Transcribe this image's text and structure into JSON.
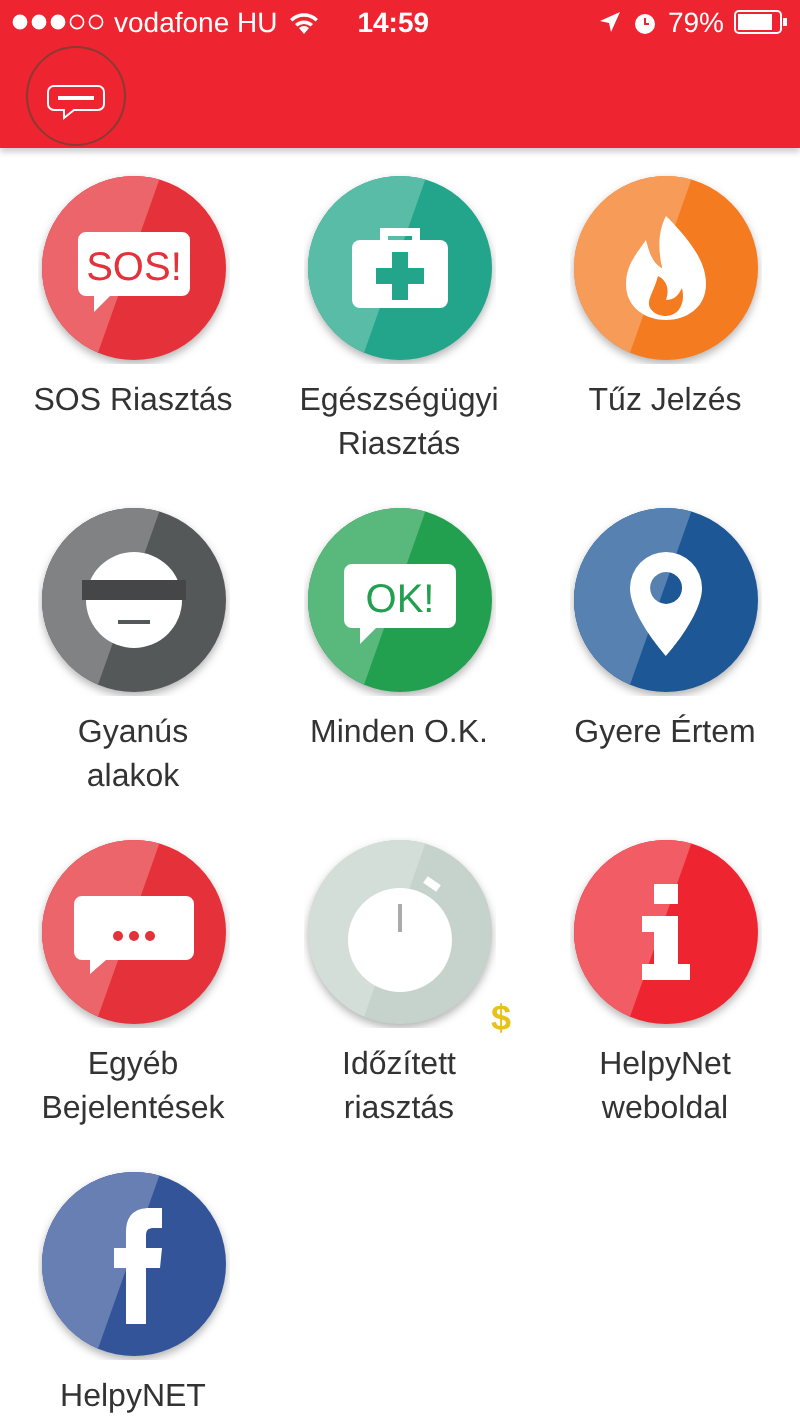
{
  "status_bar": {
    "carrier": "vodafone HU",
    "time": "14:59",
    "battery": "79%"
  },
  "tiles": [
    {
      "label": "SOS Riasztás",
      "kind": "speech",
      "icon_text": "SOS!",
      "color": "#e4313a"
    },
    {
      "label": "Egészségügyi\nRiasztás",
      "kind": "medkit",
      "color": "#22a58a"
    },
    {
      "label": "Tűz Jelzés",
      "kind": "fire",
      "color": "#f47b20"
    },
    {
      "label": "Gyanús\nalakok",
      "kind": "mask",
      "color": "#555859"
    },
    {
      "label": "Minden O.K.",
      "kind": "speech",
      "icon_text": "OK!",
      "color": "#22a050"
    },
    {
      "label": "Gyere Értem",
      "kind": "pin",
      "color": "#1d5795"
    },
    {
      "label": "Egyéb\nBejelentések",
      "kind": "dots",
      "color": "#e4313a"
    },
    {
      "label": "Időzített\nriasztás",
      "kind": "timer",
      "badge": "$",
      "color": "#c5d3cc"
    },
    {
      "label": "HelpyNet\nweboldal",
      "kind": "info",
      "color": "#ee2530"
    },
    {
      "label": "HelpyNET",
      "kind": "facebook",
      "color": "#34549a"
    }
  ]
}
